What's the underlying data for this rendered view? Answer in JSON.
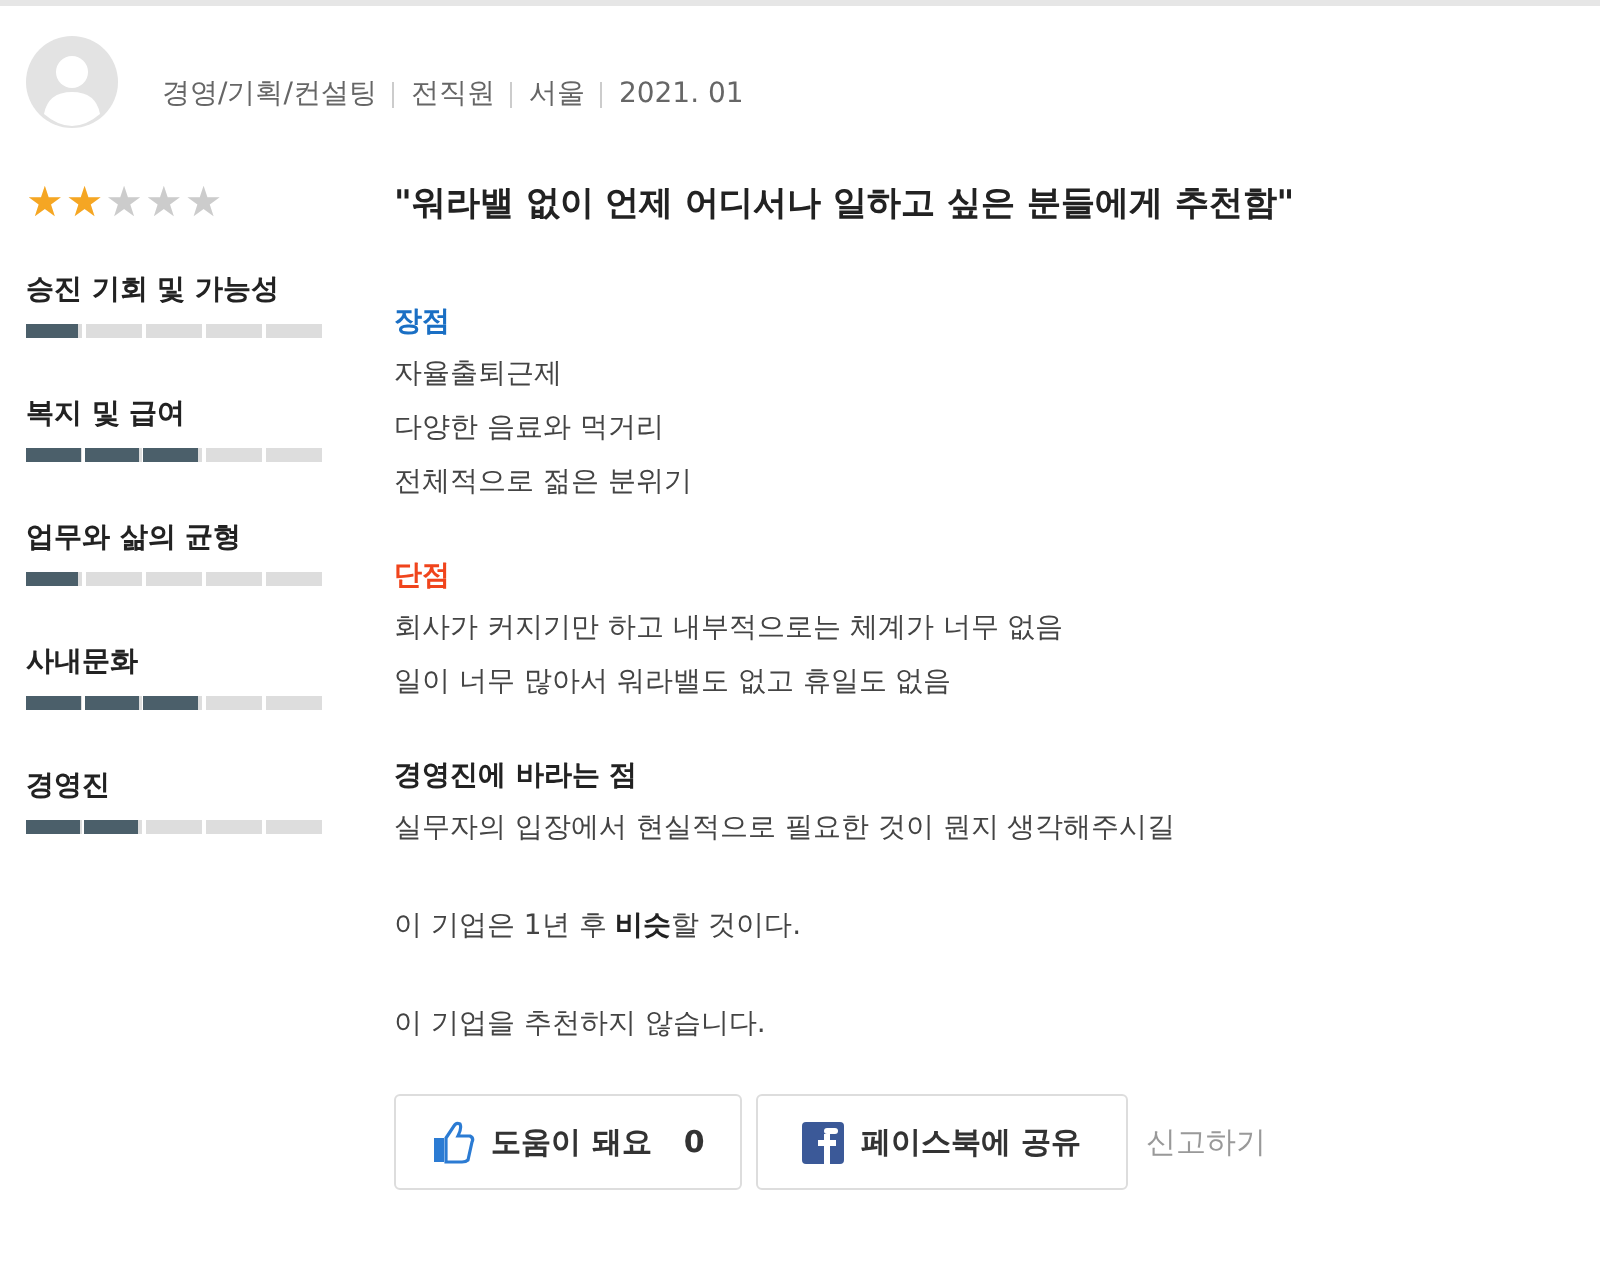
{
  "author": {
    "meta": [
      "경영/기획/컨설팅",
      "전직원",
      "서울",
      "2021. 01"
    ]
  },
  "rating": {
    "stars": 2
  },
  "categories": [
    {
      "name": "승진 기회 및 가능성",
      "level": 0.2
    },
    {
      "name": "복지 및 급여",
      "level": 0.6
    },
    {
      "name": "업무와 삶의 균형",
      "level": 0.2
    },
    {
      "name": "사내문화",
      "level": 0.6
    },
    {
      "name": "경영진",
      "level": 0.4
    }
  ],
  "review": {
    "title": "\"워라밸 없이 언제 어디서나 일하고 싶은 분들에게 추천함\"",
    "sections": [
      {
        "kind": "pros",
        "heading": "장점",
        "lines": [
          "자율출퇴근제",
          "다양한 음료와 먹거리",
          "전체적으로 젊은 분위기"
        ]
      },
      {
        "kind": "cons",
        "heading": "단점",
        "lines": [
          "회사가 커지기만 하고 내부적으로는 체계가 너무 없음",
          "일이 너무 많아서 워라밸도 없고 휴일도 없음"
        ]
      },
      {
        "kind": "wish",
        "heading": "경영진에 바라는 점",
        "lines": [
          "실무자의 입장에서 현실적으로 필요한 것이 뭔지 생각해주시길"
        ]
      }
    ],
    "outlook": "이 기업은 1년 후 **비슷**할 것이다.",
    "recommend": "이 기업을 추천하지 않습니다."
  },
  "actions": {
    "helpful_label": "도움이 돼요",
    "helpful_count": "0",
    "share_label": "페이스북에 공유",
    "report_label": "신고하기"
  }
}
